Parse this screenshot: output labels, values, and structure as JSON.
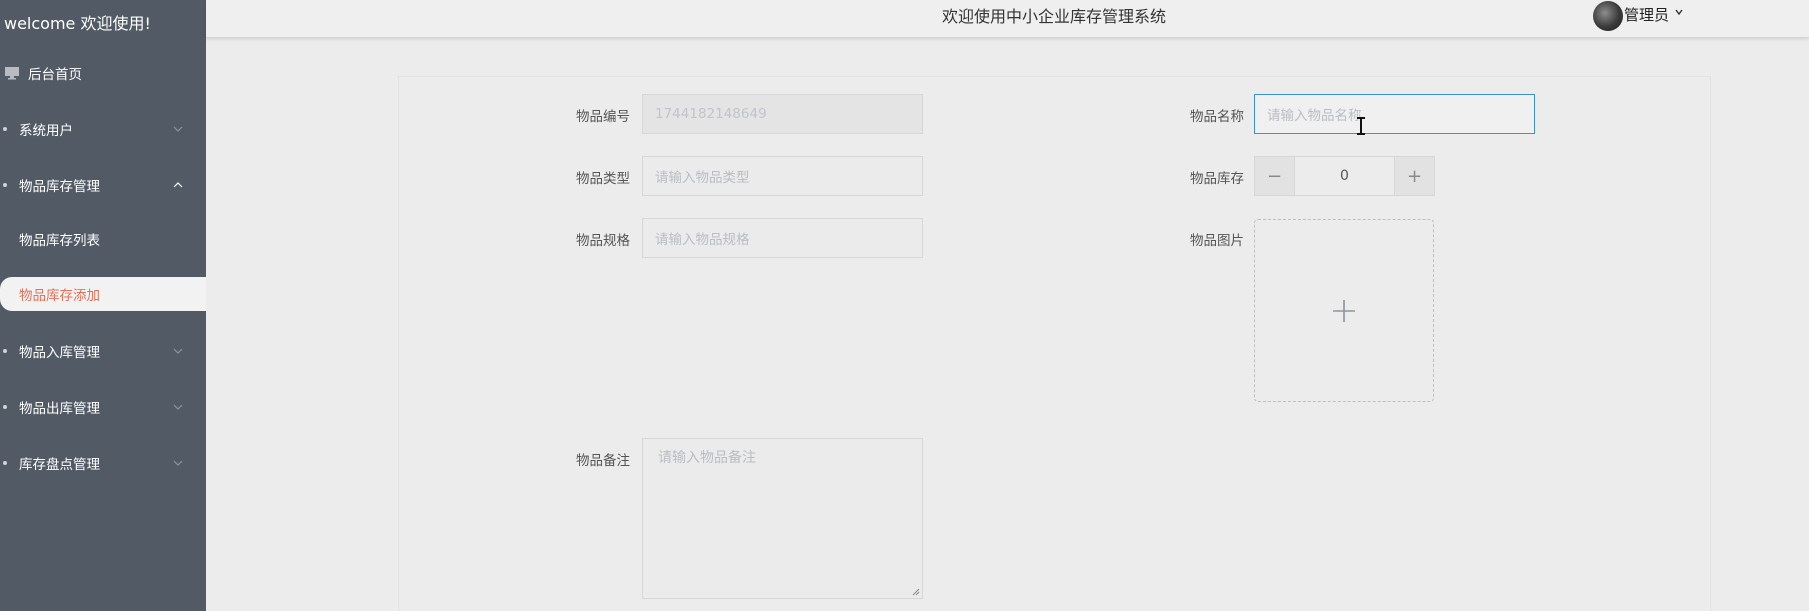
{
  "sidebar": {
    "welcome": "welcome 欢迎使用!",
    "home": "后台首页",
    "menus": [
      {
        "label": "系统用户"
      },
      {
        "label": "物品库存管理"
      },
      {
        "label": "物品入库管理"
      },
      {
        "label": "物品出库管理"
      },
      {
        "label": "库存盘点管理"
      }
    ],
    "submenus": [
      {
        "label": "物品库存列表"
      },
      {
        "label": "物品库存添加"
      }
    ]
  },
  "header": {
    "title": "欢迎使用中小企业库存管理系统",
    "user": "管理员"
  },
  "form": {
    "code": {
      "label": "物品编号",
      "value": "1744182148649"
    },
    "name": {
      "label": "物品名称",
      "placeholder": "请输入物品名称"
    },
    "type": {
      "label": "物品类型",
      "placeholder": "请输入物品类型"
    },
    "stock": {
      "label": "物品库存",
      "value": "0",
      "minus": "−",
      "plus": "+"
    },
    "spec": {
      "label": "物品规格",
      "placeholder": "请输入物品规格"
    },
    "image": {
      "label": "物品图片"
    },
    "remark": {
      "label": "物品备注",
      "placeholder": "请输入物品备注"
    }
  },
  "colors": {
    "sidebar_bg": "#525b65",
    "active_text": "#e2725a",
    "focus_border": "#3d8fd6"
  }
}
